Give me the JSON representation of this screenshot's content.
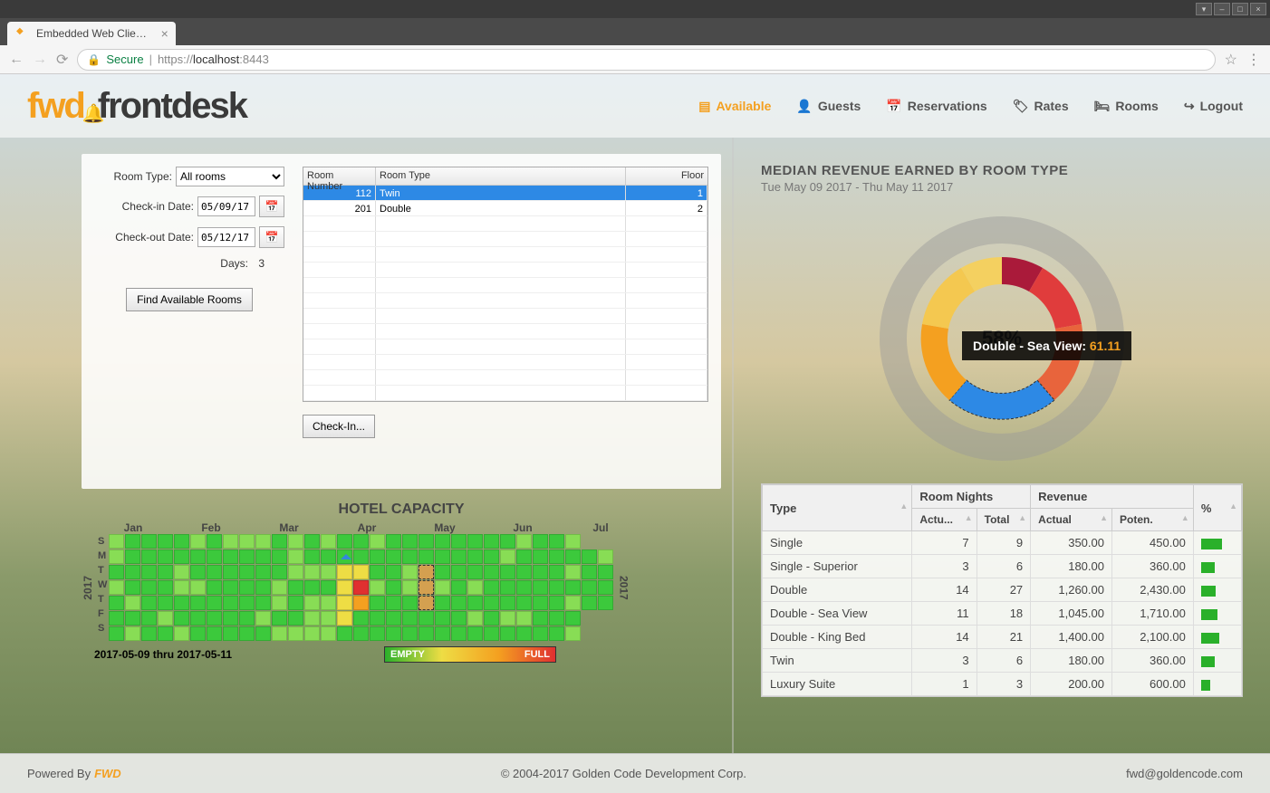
{
  "window": {
    "title": "Embedded Web Clie…"
  },
  "browser": {
    "tab_title": "Embedded Web Clie…",
    "secure_label": "Secure",
    "url_prefix": "https://",
    "url_host": "localhost",
    "url_port": ":8443"
  },
  "logo": {
    "part1": "fwd",
    "part2": "frontdesk"
  },
  "nav": {
    "available": "Available",
    "guests": "Guests",
    "reservations": "Reservations",
    "rates": "Rates",
    "rooms": "Rooms",
    "logout": "Logout"
  },
  "search_form": {
    "room_type_label": "Room Type:",
    "room_type_value": "All rooms",
    "checkin_label": "Check-in Date:",
    "checkin_value": "05/09/17",
    "checkout_label": "Check-out Date:",
    "checkout_value": "05/12/17",
    "days_label": "Days:",
    "days_value": "3",
    "find_button": "Find Available Rooms",
    "checkin_button": "Check-In..."
  },
  "room_table": {
    "headers": {
      "number": "Room Number",
      "type": "Room Type",
      "floor": "Floor"
    },
    "rows": [
      {
        "number": "112",
        "type": "Twin",
        "floor": "1",
        "selected": true
      },
      {
        "number": "201",
        "type": "Double",
        "floor": "2",
        "selected": false
      }
    ]
  },
  "capacity": {
    "title": "HOTEL CAPACITY",
    "year": "2017",
    "months": [
      "Jan",
      "Feb",
      "Mar",
      "Apr",
      "May",
      "Jun",
      "Jul"
    ],
    "days": [
      "S",
      "M",
      "T",
      "W",
      "T",
      "F",
      "S"
    ],
    "date_range": "2017-05-09 thru 2017-05-11",
    "legend_empty": "EMPTY",
    "legend_full": "FULL"
  },
  "chart": {
    "title": "MEDIAN REVENUE EARNED BY ROOM TYPE",
    "subtitle": "Tue May 09 2017 - Thu May 11 2017",
    "center_pct": "58%",
    "tooltip_label": "Double - Sea View: ",
    "tooltip_value": "61.11"
  },
  "chart_data": {
    "type": "pie",
    "title": "MEDIAN REVENUE EARNED BY ROOM TYPE",
    "subtitle": "Tue May 09 2017 - Thu May 11 2017",
    "center_label": "58%",
    "highlighted_slice": {
      "name": "Double - Sea View",
      "value": 61.11
    },
    "series": [
      {
        "name": "Single",
        "actual": 350.0,
        "potential": 450.0,
        "color": "#aa1a3a"
      },
      {
        "name": "Single - Superior",
        "actual": 180.0,
        "potential": 360.0,
        "color": "#e03c3c"
      },
      {
        "name": "Double",
        "actual": 1260.0,
        "potential": 2430.0,
        "color": "#e8643c"
      },
      {
        "name": "Double - Sea View",
        "actual": 1045.0,
        "potential": 1710.0,
        "color": "#2d89e5"
      },
      {
        "name": "Double - King Bed",
        "actual": 1400.0,
        "potential": 2100.0,
        "color": "#f4a020"
      },
      {
        "name": "Twin",
        "actual": 180.0,
        "potential": 360.0,
        "color": "#f4c850"
      },
      {
        "name": "Luxury Suite",
        "actual": 200.0,
        "potential": 600.0,
        "color": "#f4d060"
      }
    ]
  },
  "revenue_table": {
    "headers": {
      "type": "Type",
      "room_nights": "Room Nights",
      "revenue": "Revenue",
      "pct": "%",
      "actual_short": "Actu...",
      "total": "Total",
      "actual": "Actual",
      "potential": "Poten."
    },
    "rows": [
      {
        "type": "Single",
        "nights_actual": 7,
        "nights_total": 9,
        "rev_actual": "350.00",
        "rev_potential": "450.00",
        "pct": 78
      },
      {
        "type": "Single - Superior",
        "nights_actual": 3,
        "nights_total": 6,
        "rev_actual": "180.00",
        "rev_potential": "360.00",
        "pct": 50
      },
      {
        "type": "Double",
        "nights_actual": 14,
        "nights_total": 27,
        "rev_actual": "1,260.00",
        "rev_potential": "2,430.00",
        "pct": 52
      },
      {
        "type": "Double - Sea View",
        "nights_actual": 11,
        "nights_total": 18,
        "rev_actual": "1,045.00",
        "rev_potential": "1,710.00",
        "pct": 61
      },
      {
        "type": "Double - King Bed",
        "nights_actual": 14,
        "nights_total": 21,
        "rev_actual": "1,400.00",
        "rev_potential": "2,100.00",
        "pct": 67
      },
      {
        "type": "Twin",
        "nights_actual": 3,
        "nights_total": 6,
        "rev_actual": "180.00",
        "rev_potential": "360.00",
        "pct": 50
      },
      {
        "type": "Luxury Suite",
        "nights_actual": 1,
        "nights_total": 3,
        "rev_actual": "200.00",
        "rev_potential": "600.00",
        "pct": 33
      }
    ]
  },
  "footer": {
    "powered_by": "Powered By",
    "fwd_logo": "FWD",
    "copyright": "© 2004-2017 Golden Code Development Corp.",
    "email": "fwd@goldencode.com"
  }
}
